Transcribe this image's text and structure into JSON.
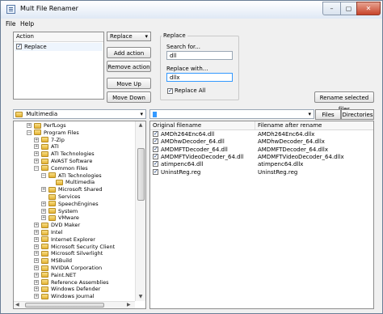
{
  "window": {
    "title": "Mult File Renamer",
    "minimize": "–",
    "maximize": "▢",
    "close": "✕"
  },
  "menu": [
    "File",
    "Help"
  ],
  "actions": {
    "header": "Action",
    "items": [
      {
        "label": "Replace",
        "checked": true
      }
    ]
  },
  "action_type": {
    "selected": "Replace",
    "arrow": "▾"
  },
  "buttons": {
    "add": "Add action",
    "remove": "Remove action",
    "up": "Move Up",
    "down": "Move Down",
    "rename": "Rename selected files"
  },
  "replace": {
    "group_label": "Replace",
    "search_label": "Search for...",
    "search_value": "dll",
    "with_label": "Replace with...",
    "with_value": "dllx",
    "replace_all_label": "Replace All",
    "replace_all_checked": true
  },
  "path": {
    "value": "Multimedia",
    "arrow": "▾"
  },
  "filter": {
    "value": "",
    "arrow": "▾",
    "files_tab": "Files",
    "dirs_tab": "Directories"
  },
  "tree": [
    {
      "label": "PerfLogs",
      "indent": 1,
      "exp": "+"
    },
    {
      "label": "Program Files",
      "indent": 1,
      "exp": "−"
    },
    {
      "label": "7-Zip",
      "indent": 2,
      "exp": "+"
    },
    {
      "label": "ATI",
      "indent": 2,
      "exp": "+"
    },
    {
      "label": "ATI Technologies",
      "indent": 2,
      "exp": "+"
    },
    {
      "label": "AVAST Software",
      "indent": 2,
      "exp": "+"
    },
    {
      "label": "Common Files",
      "indent": 2,
      "exp": "−"
    },
    {
      "label": "ATI Technologies",
      "indent": 3,
      "exp": "−"
    },
    {
      "label": "Multimedia",
      "indent": 4,
      "exp": ""
    },
    {
      "label": "Microsoft Shared",
      "indent": 3,
      "exp": "+"
    },
    {
      "label": "Services",
      "indent": 3,
      "exp": ""
    },
    {
      "label": "SpeechEngines",
      "indent": 3,
      "exp": "+"
    },
    {
      "label": "System",
      "indent": 3,
      "exp": "+"
    },
    {
      "label": "VMware",
      "indent": 3,
      "exp": "+"
    },
    {
      "label": "DVD Maker",
      "indent": 2,
      "exp": "+"
    },
    {
      "label": "Intel",
      "indent": 2,
      "exp": "+"
    },
    {
      "label": "Internet Explorer",
      "indent": 2,
      "exp": "+"
    },
    {
      "label": "Microsoft Security Client",
      "indent": 2,
      "exp": "+"
    },
    {
      "label": "Microsoft Silverlight",
      "indent": 2,
      "exp": "+"
    },
    {
      "label": "MSBuild",
      "indent": 2,
      "exp": "+"
    },
    {
      "label": "NVIDIA Corporation",
      "indent": 2,
      "exp": "+"
    },
    {
      "label": "Paint.NET",
      "indent": 2,
      "exp": "+"
    },
    {
      "label": "Reference Assemblies",
      "indent": 2,
      "exp": "+"
    },
    {
      "label": "Windows Defender",
      "indent": 2,
      "exp": "+"
    },
    {
      "label": "Windows Journal",
      "indent": 2,
      "exp": "+"
    }
  ],
  "files": {
    "col_original": "Original filename",
    "col_after": "Filename after rename",
    "rows": [
      {
        "orig": "AMDh264Enc64.dll",
        "after": "AMDh264Enc64.dllx",
        "checked": true
      },
      {
        "orig": "AMDhwDecoder_64.dll",
        "after": "AMDhwDecoder_64.dllx",
        "checked": true
      },
      {
        "orig": "AMDMFTDecoder_64.dll",
        "after": "AMDMFTDecoder_64.dllx",
        "checked": true
      },
      {
        "orig": "AMDMFTVideoDecoder_64.dll",
        "after": "AMDMFTVideoDecoder_64.dllx",
        "checked": true
      },
      {
        "orig": "atimpenc64.dll",
        "after": "atimpenc64.dllx",
        "checked": true
      },
      {
        "orig": "UninstReg.reg",
        "after": "UninstReg.reg",
        "checked": true
      }
    ]
  },
  "scroll": {
    "up": "▲",
    "down": "▼",
    "left": "◀",
    "right": "▶"
  },
  "colors": {
    "accent": "#3399ff",
    "selection": "#cde8ff"
  }
}
